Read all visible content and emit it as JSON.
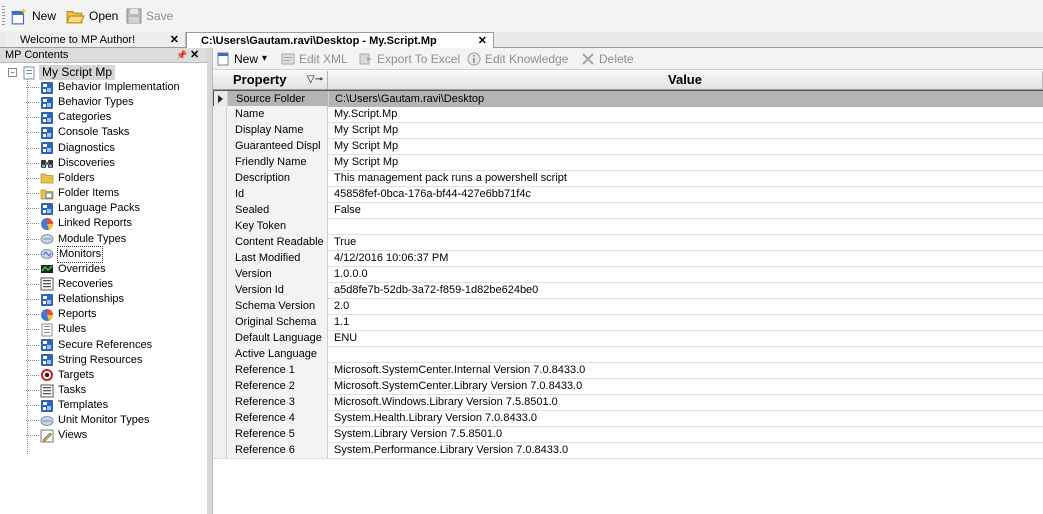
{
  "toolbar": {
    "new_label": "New",
    "open_label": "Open",
    "save_label": "Save"
  },
  "tabs": [
    {
      "label": "Welcome to MP Author!",
      "close": "✕"
    },
    {
      "label": "C:\\Users\\Gautam.ravi\\Desktop - My.Script.Mp",
      "close": "✕"
    }
  ],
  "left_panel": {
    "title": "MP Contents",
    "pin": "📌",
    "close": "✕",
    "expander": "−",
    "root": "My Script Mp",
    "items": [
      {
        "label": "Behavior Implementation",
        "icon": "blue-doc-icon"
      },
      {
        "label": "Behavior Types",
        "icon": "blue-doc-icon"
      },
      {
        "label": "Categories",
        "icon": "blue-doc-icon"
      },
      {
        "label": "Console Tasks",
        "icon": "blue-doc-icon"
      },
      {
        "label": "Diagnostics",
        "icon": "blue-doc-icon"
      },
      {
        "label": "Discoveries",
        "icon": "binoculars-icon"
      },
      {
        "label": "Folders",
        "icon": "folder-icon"
      },
      {
        "label": "Folder Items",
        "icon": "folder-items-icon"
      },
      {
        "label": "Language Packs",
        "icon": "blue-doc-icon"
      },
      {
        "label": "Linked Reports",
        "icon": "pie-chart-icon"
      },
      {
        "label": "Module Types",
        "icon": "module-icon"
      },
      {
        "label": "Monitors",
        "icon": "monitor-icon"
      },
      {
        "label": "Overrides",
        "icon": "override-icon"
      },
      {
        "label": "Recoveries",
        "icon": "list-icon"
      },
      {
        "label": "Relationships",
        "icon": "blue-doc-icon"
      },
      {
        "label": "Reports",
        "icon": "pie-chart-icon"
      },
      {
        "label": "Rules",
        "icon": "rules-icon"
      },
      {
        "label": "Secure References",
        "icon": "blue-doc-icon"
      },
      {
        "label": "String Resources",
        "icon": "blue-doc-icon"
      },
      {
        "label": "Targets",
        "icon": "target-icon"
      },
      {
        "label": "Tasks",
        "icon": "list-icon"
      },
      {
        "label": "Templates",
        "icon": "blue-doc-icon"
      },
      {
        "label": "Unit Monitor Types",
        "icon": "module-icon"
      },
      {
        "label": "Views",
        "icon": "pencil-icon"
      }
    ]
  },
  "content_toolbar": {
    "new_label": "New",
    "dropdown_arrow": "▾",
    "edit_xml_label": "Edit XML",
    "export_label": "Export To Excel",
    "edit_knowledge_label": "Edit Knowledge",
    "delete_label": "Delete"
  },
  "grid": {
    "header_property": "Property",
    "header_filter": "▽⊸",
    "header_value": "Value",
    "rows": [
      {
        "property": "Source Folder",
        "value": "C:\\Users\\Gautam.ravi\\Desktop"
      },
      {
        "property": "Name",
        "value": "My.Script.Mp"
      },
      {
        "property": "Display Name",
        "value": "My Script Mp"
      },
      {
        "property": "Guaranteed Displ",
        "value": "My Script Mp"
      },
      {
        "property": "Friendly Name",
        "value": "My Script Mp"
      },
      {
        "property": "Description",
        "value": "This management pack runs a powershell script"
      },
      {
        "property": "Id",
        "value": "45858fef-0bca-176a-bf44-427e6bb71f4c"
      },
      {
        "property": "Sealed",
        "value": "False"
      },
      {
        "property": "Key Token",
        "value": ""
      },
      {
        "property": "Content Readable",
        "value": "True"
      },
      {
        "property": "Last Modified",
        "value": "4/12/2016 10:06:37 PM"
      },
      {
        "property": "Version",
        "value": "1.0.0.0"
      },
      {
        "property": "Version Id",
        "value": "a5d8fe7b-52db-3a72-f859-1d82be624be0"
      },
      {
        "property": "Schema Version",
        "value": "2.0"
      },
      {
        "property": "Original Schema",
        "value": "1.1"
      },
      {
        "property": "Default Language",
        "value": "ENU"
      },
      {
        "property": "Active Language",
        "value": ""
      },
      {
        "property": "Reference 1",
        "value": "Microsoft.SystemCenter.Internal Version 7.0.8433.0"
      },
      {
        "property": "Reference 2",
        "value": "Microsoft.SystemCenter.Library Version 7.0.8433.0"
      },
      {
        "property": "Reference 3",
        "value": "Microsoft.Windows.Library Version 7.5.8501.0"
      },
      {
        "property": "Reference 4",
        "value": "System.Health.Library Version 7.0.8433.0"
      },
      {
        "property": "Reference 5",
        "value": "System.Library Version 7.5.8501.0"
      },
      {
        "property": "Reference 6",
        "value": "System.Performance.Library Version 7.0.8433.0"
      }
    ]
  },
  "colors": {
    "panel_bg": "#f3f3f3",
    "selected_row": "#b4b4b4",
    "accent_blue": "#2f63b8"
  }
}
